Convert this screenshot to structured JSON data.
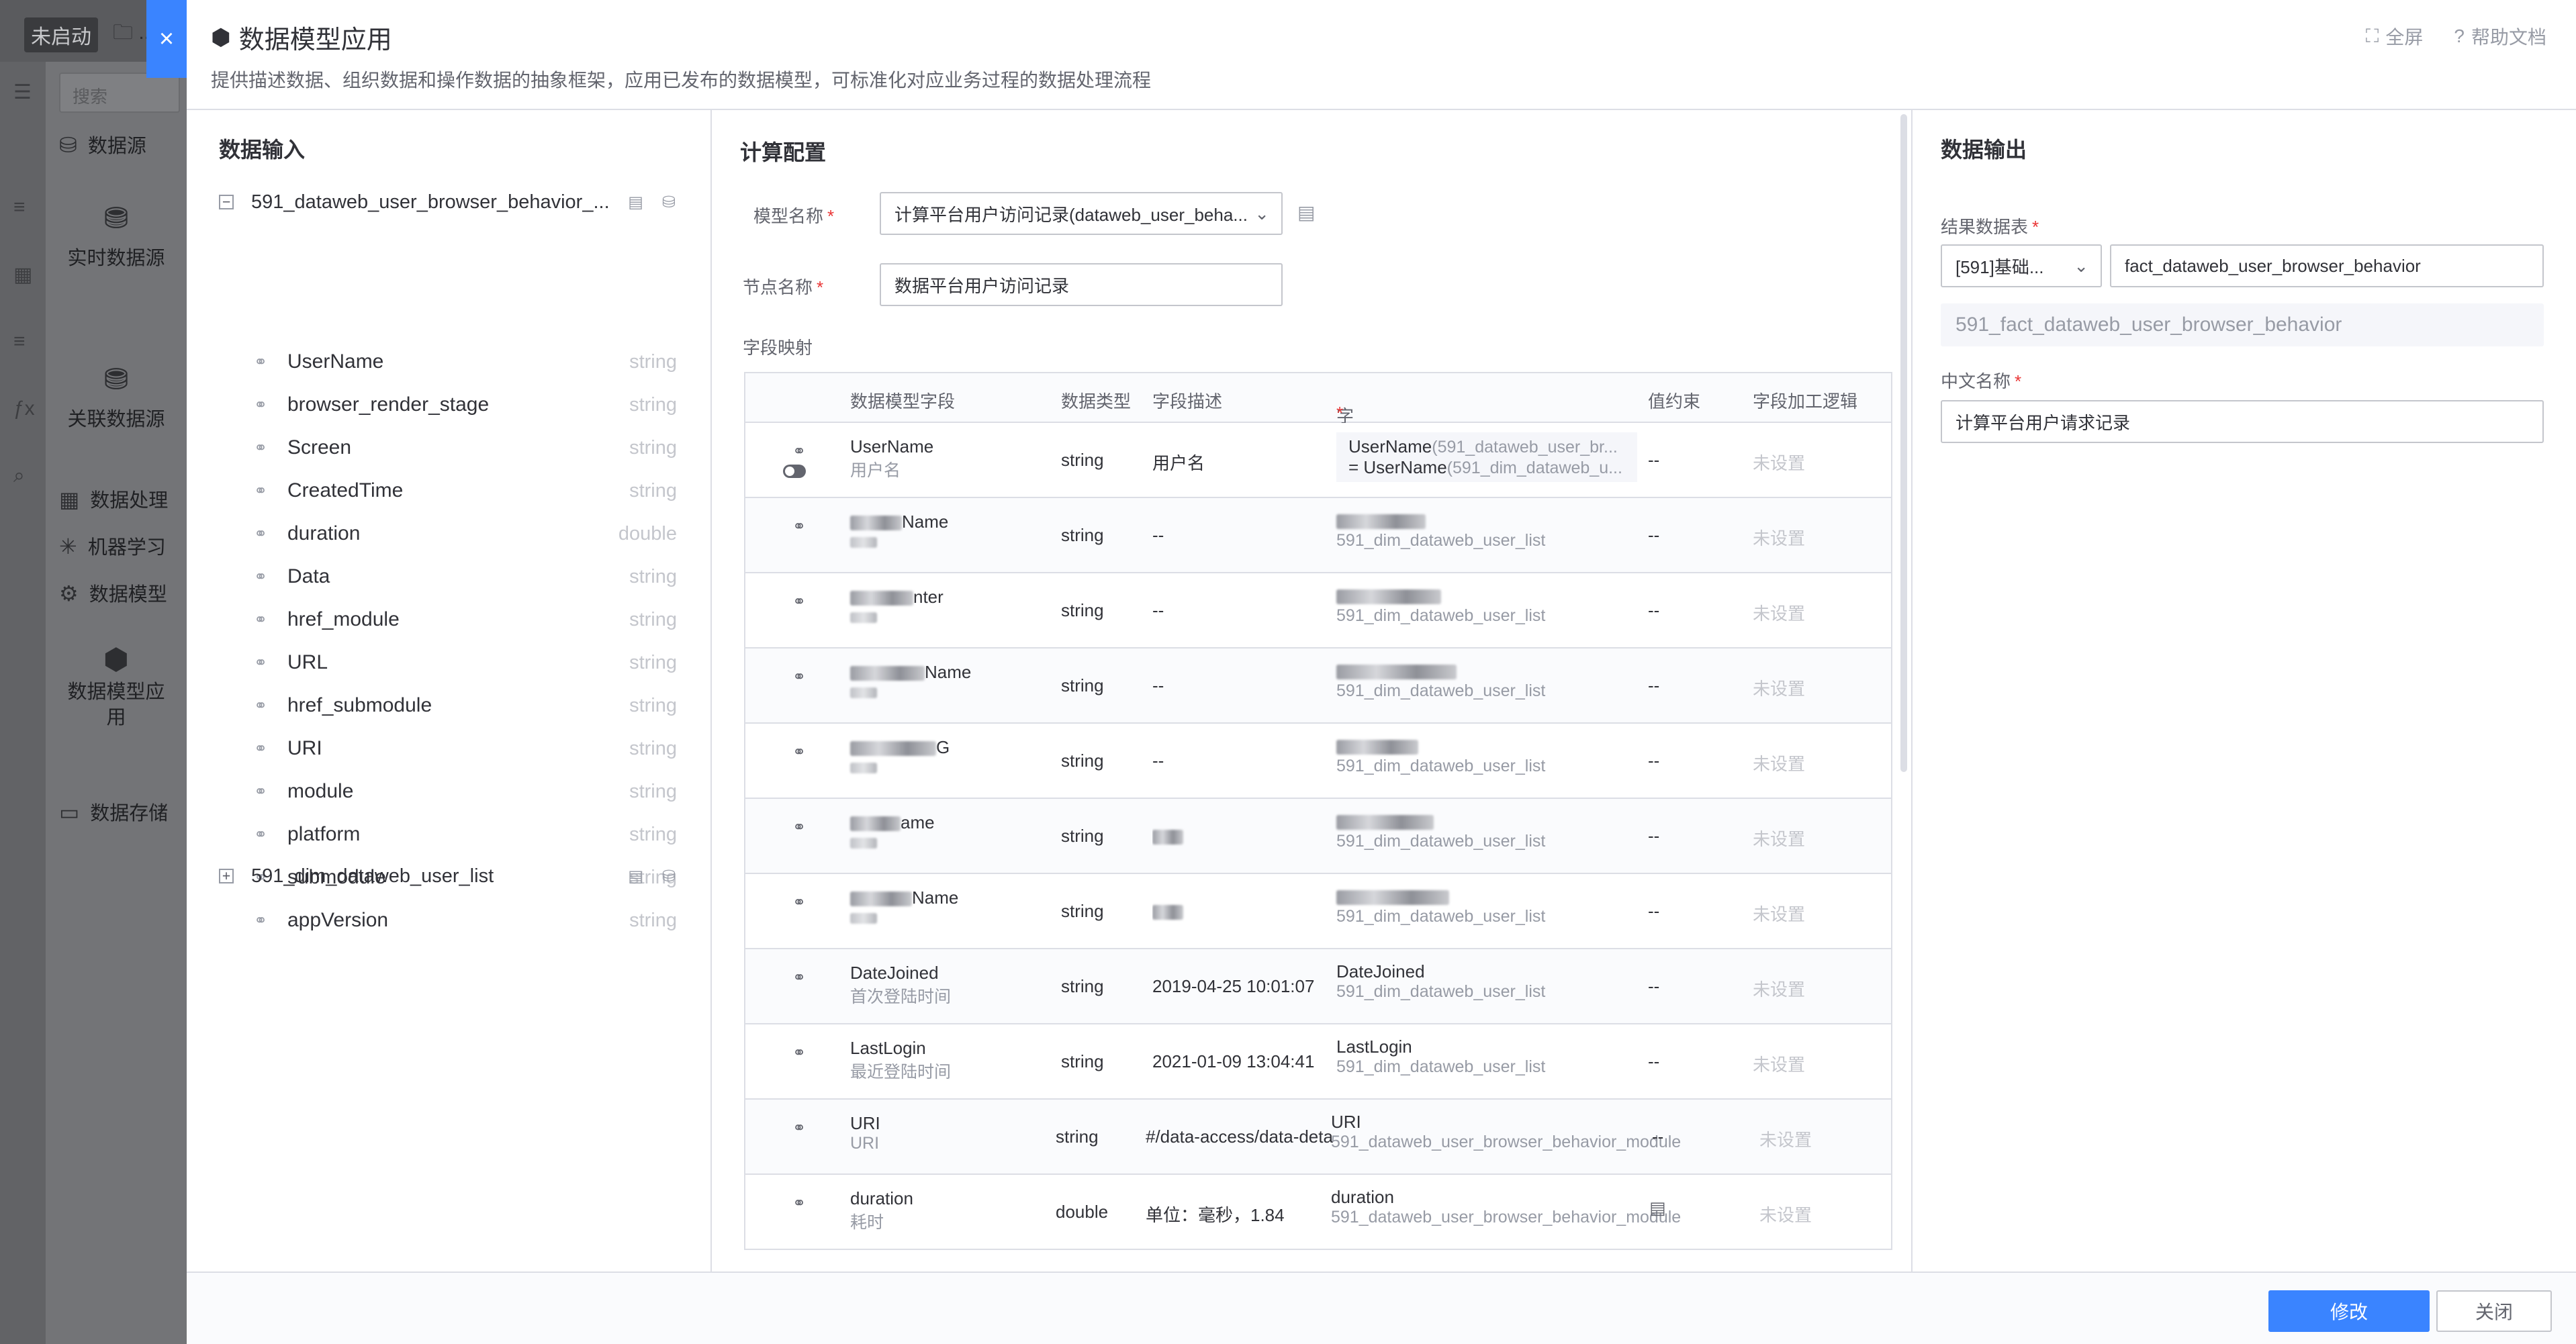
{
  "background": {
    "status_badge": "未启动",
    "search_placeholder": "搜索",
    "sidebar": [
      {
        "label": "数据源",
        "icon": "data-source-icon"
      },
      {
        "label": "实时数据源",
        "icon": "realtime-source-icon"
      },
      {
        "label": "关联数据源",
        "icon": "related-source-icon"
      },
      {
        "label": "数据处理",
        "icon": "processing-icon"
      },
      {
        "label": "机器学习",
        "icon": "ml-icon"
      },
      {
        "label": "数据模型",
        "icon": "model-icon"
      },
      {
        "label": "数据模型应用",
        "icon": "model-app-icon"
      },
      {
        "label": "数据存储",
        "icon": "storage-icon"
      }
    ]
  },
  "dialog": {
    "title": "数据模型应用",
    "subtitle": "提供描述数据、组织数据和操作数据的抽象框架，应用已发布的数据模型，可标准化对应业务过程的数据处理流程",
    "fullscreen_label": "全屏",
    "help_label": "帮助文档",
    "close_symbol": "×"
  },
  "input_pane": {
    "title": "数据输入",
    "tables": [
      {
        "name": "591_dataweb_user_browser_behavior_...",
        "expanded": true
      },
      {
        "name": "591_dim_dataweb_user_list",
        "expanded": false
      }
    ],
    "fields": [
      {
        "name": "UserName",
        "type": "string"
      },
      {
        "name": "browser_render_stage",
        "type": "string"
      },
      {
        "name": "Screen",
        "type": "string"
      },
      {
        "name": "CreatedTime",
        "type": "string"
      },
      {
        "name": "duration",
        "type": "double"
      },
      {
        "name": "Data",
        "type": "string"
      },
      {
        "name": "href_module",
        "type": "string"
      },
      {
        "name": "URL",
        "type": "string"
      },
      {
        "name": "href_submodule",
        "type": "string"
      },
      {
        "name": "URI",
        "type": "string"
      },
      {
        "name": "module",
        "type": "string"
      },
      {
        "name": "platform",
        "type": "string"
      },
      {
        "name": "submodule",
        "type": "string"
      },
      {
        "name": "appVersion",
        "type": "string"
      }
    ]
  },
  "config_pane": {
    "title": "计算配置",
    "model_label": "模型名称",
    "model_value": "计算平台用户访问记录(dataweb_user_beha...",
    "node_label": "节点名称",
    "node_value": "数据平台用户访问记录",
    "mapping_label": "字段映射",
    "columns": {
      "field": "数据模型字段",
      "type": "数据类型",
      "desc": "字段描述",
      "mapping": "字段映射",
      "constraint": "值约束",
      "logic": "字段加工逻辑"
    },
    "rows": [
      {
        "f1": "UserName",
        "f2": "用户名",
        "type": "string",
        "desc": "用户名",
        "m1a": "UserName",
        "m1b": "(591_dataweb_user_br...",
        "m2a": "= UserName",
        "m2b": "(591_dim_dataweb_u...",
        "cons": "--",
        "logic": "未设置"
      },
      {
        "f1": "Name",
        "f2": "",
        "type": "string",
        "desc": "--",
        "m1a": "",
        "m1b": "",
        "m2a": "591_dim_dataweb_user_list",
        "m2b": "",
        "cons": "--",
        "logic": "未设置"
      },
      {
        "f1": "nter",
        "f2": "",
        "type": "string",
        "desc": "--",
        "m1a": "",
        "m1b": "",
        "m2a": "591_dim_dataweb_user_list",
        "m2b": "",
        "cons": "--",
        "logic": "未设置"
      },
      {
        "f1": "Name",
        "f2": "",
        "type": "string",
        "desc": "--",
        "m1a": "",
        "m1b": "",
        "m2a": "591_dim_dataweb_user_list",
        "m2b": "",
        "cons": "--",
        "logic": "未设置"
      },
      {
        "f1": "G",
        "f2": "",
        "type": "string",
        "desc": "--",
        "m1a": "",
        "m1b": "",
        "m2a": "591_dim_dataweb_user_list",
        "m2b": "",
        "cons": "--",
        "logic": "未设置"
      },
      {
        "f1": "ame",
        "f2": "",
        "type": "string",
        "desc": "",
        "m1a": "",
        "m1b": "",
        "m2a": "591_dim_dataweb_user_list",
        "m2b": "",
        "cons": "--",
        "logic": "未设置"
      },
      {
        "f1": "Name",
        "f2": "",
        "type": "string",
        "desc": "",
        "m1a": "",
        "m1b": "",
        "m2a": "591_dim_dataweb_user_list",
        "m2b": "",
        "cons": "--",
        "logic": "未设置"
      },
      {
        "f1": "DateJoined",
        "f2": "首次登陆时间",
        "type": "string",
        "desc": "2019-04-25 10:01:07",
        "m1a": "DateJoined",
        "m1b": "",
        "m2a": "591_dim_dataweb_user_list",
        "m2b": "",
        "cons": "--",
        "logic": "未设置"
      },
      {
        "f1": "LastLogin",
        "f2": "最近登陆时间",
        "type": "string",
        "desc": "2021-01-09 13:04:41",
        "m1a": "LastLogin",
        "m1b": "",
        "m2a": "591_dim_dataweb_user_list",
        "m2b": "",
        "cons": "--",
        "logic": "未设置"
      },
      {
        "f1": "URI",
        "f2": "URI",
        "type": "string",
        "desc": "#/data-access/data-deta",
        "m1a": "URI",
        "m1b": "",
        "m2a": "591_dataweb_user_browser_behavior_module",
        "m2b": "",
        "cons": "--",
        "logic": "未设置"
      },
      {
        "f1": "duration",
        "f2": "耗时",
        "type": "double",
        "desc": "单位：毫秒，1.84",
        "m1a": "duration",
        "m1b": "",
        "m2a": "591_dataweb_user_browser_behavior_module",
        "m2b": "",
        "cons": "",
        "logic": "未设置"
      }
    ]
  },
  "output_pane": {
    "title": "数据输出",
    "result_label": "结果数据表",
    "biz_select": "[591]基础...",
    "table_name": "fact_dataweb_user_browser_behavior",
    "full_name": "591_fact_dataweb_user_browser_behavior",
    "cn_label": "中文名称",
    "cn_value": "计算平台用户请求记录"
  },
  "footer": {
    "submit_label": "修改",
    "close_label": "关闭"
  },
  "colors": {
    "primary": "#3a84ff",
    "required": "#ea3636",
    "border": "#dcdee5"
  }
}
